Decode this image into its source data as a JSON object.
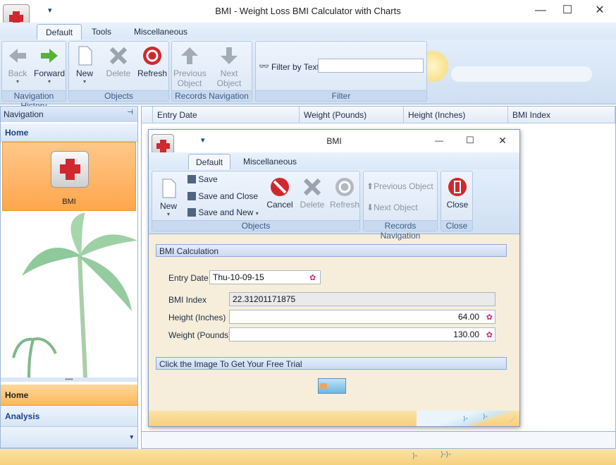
{
  "window": {
    "title": "BMI - Weight Loss BMI Calculator with Charts",
    "qat_arrow": "▾",
    "minimize": "—",
    "maximize": "☐",
    "close": "✕"
  },
  "tabs": [
    "Default",
    "Tools",
    "Miscellaneous"
  ],
  "ribbon": {
    "nav_history": {
      "label": "Navigation History",
      "back": "Back",
      "forward": "Forward"
    },
    "objects": {
      "label": "Objects",
      "new": "New",
      "delete": "Delete",
      "refresh": "Refresh"
    },
    "records_navigation": {
      "label": "Records Navigation",
      "previous": "Previous Object",
      "next": "Next Object"
    },
    "filter": {
      "label": "Filter",
      "filter_by_text": "Filter by Text",
      "value": ""
    }
  },
  "navigation": {
    "header": "Navigation",
    "pin": "⊣",
    "home_section": "Home",
    "item_bmi": "BMI",
    "bottom_home": "Home",
    "bottom_analysis": "Analysis",
    "more": "▾"
  },
  "grid": {
    "columns": [
      "Entry Date",
      "Weight (Pounds)",
      "Height (Inches)",
      "BMI Index"
    ]
  },
  "dialog": {
    "title": "BMI",
    "tabs": [
      "Default",
      "Miscellaneous"
    ],
    "toolbar": {
      "new": "New",
      "save": "Save",
      "save_close": "Save and Close",
      "save_new": "Save and New",
      "cancel": "Cancel",
      "delete": "Delete",
      "refresh": "Refresh",
      "previous": "Previous Object",
      "next": "Next Object",
      "close": "Close",
      "group_objects": "Objects",
      "group_records": "Records Navigation",
      "group_close": "Close"
    },
    "section_calc": "BMI Calculation",
    "fields": {
      "entry_date_label": "Entry Date",
      "entry_date": "Thu-10-09-15",
      "bmi_label": "BMI Index",
      "bmi": "22.31201171875",
      "height_label": "Height (Inches)",
      "height": "64.00",
      "weight_label": "Weight (Pounds)",
      "weight": "130.00"
    },
    "section_trial": "Click the Image To Get Your Free Trial"
  },
  "colors": {
    "accent": "#9ab6d9",
    "selection_orange": "#ffb85a",
    "delete_red": "#d0282e"
  }
}
